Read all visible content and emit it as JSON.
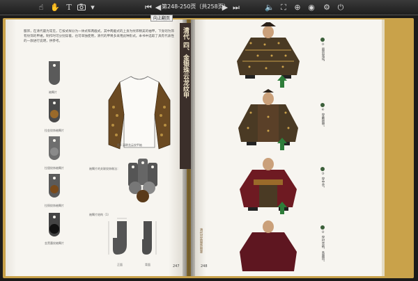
{
  "toolbar": {
    "page_indicator": "第248-250页（共258页）",
    "tag": "向上翻页"
  },
  "left_page": {
    "body": "服饰，在清代最为常见，它按式样分为一体式和两截式。其中两截式的上身为纹饰精美的袖甲，下身则为饰有纹饰的甲裙。制作时可分别穿着，也可单独使用，清代的甲胄多采用此种形式。本书中选取了具有代表性的一款进行说明，供参考。",
    "swatches": [
      {
        "label": "袖臂片",
        "color": "#5a5a5a",
        "hole": true
      },
      {
        "label": "拉金纹饰袖臂片",
        "color": "#4a4a4a",
        "circle": "#9a6a2a"
      },
      {
        "label": "拉银纹饰袖臂片",
        "color": "#6e6e6e",
        "circle": "#8a8a8a"
      },
      {
        "label": "拉铜纹饰袖臂片",
        "color": "#5a5a5a",
        "circle": "#7a4a1a"
      },
      {
        "label": "金黑墨纹袖臂片",
        "color": "#444444",
        "circle": "#111111"
      }
    ],
    "shirt_caption": "图3 清朝龙云纹甲袖",
    "combo_caption": "袖臂片的关联纹饰做法：",
    "pattern_caption": "袖臂片结构（1）",
    "pattern_labels": [
      "正面",
      "背面"
    ],
    "page_number": "247"
  },
  "right_page": {
    "title": "清代 四、金银珠云龙纹甲",
    "steps": [
      {
        "caption": "⑤ 最后完成。"
      },
      {
        "caption": "④ 穿戴披甲。"
      },
      {
        "caption": "③ 穿中衣。"
      },
      {
        "caption": "② 穿衬衣裤，系腰带。"
      }
    ],
    "side_note": "清代宫廷服饰图鉴",
    "page_number": "248"
  },
  "colors": {
    "accent_green": "#2e7d3a",
    "armor_brown": "#5a3a1e",
    "robe_red": "#6e1a22",
    "toolbar": "#2a2a2a"
  }
}
